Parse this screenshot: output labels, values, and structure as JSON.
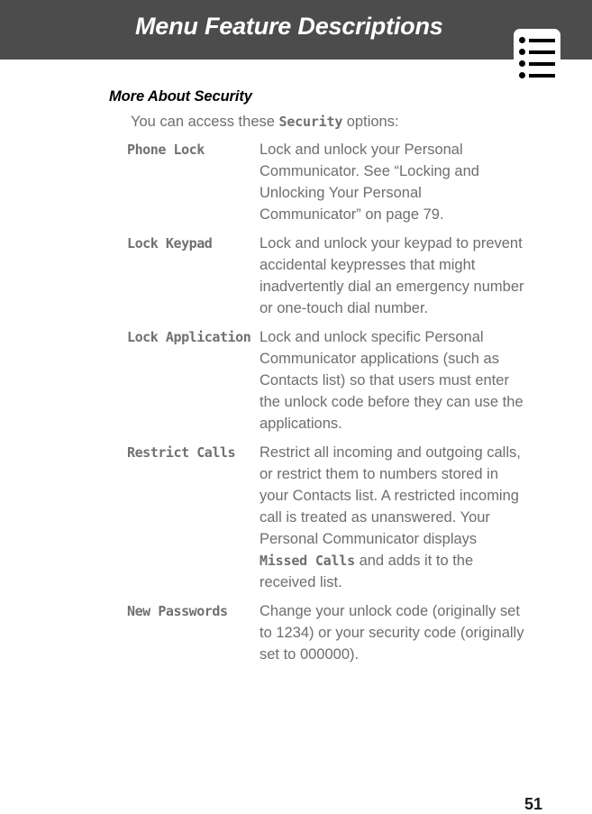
{
  "header": {
    "title": "Menu Feature Descriptions",
    "bar_color": "#4C4C4C",
    "title_color": "#FFFFFF",
    "icon_name": "bulleted-list-icon"
  },
  "section": {
    "heading": "More About Security",
    "intro_prefix": "You can access these ",
    "intro_keyword": "Security",
    "intro_suffix": " options:"
  },
  "definitions": [
    {
      "term": "Phone Lock",
      "description": "Lock and unlock your Personal Communicator. See “Locking and Unlocking Your Personal Communicator” on page 79."
    },
    {
      "term": "Lock Keypad",
      "description": "Lock and unlock your keypad to prevent accidental keypresses that might inadvertently dial an emergency number or one-touch dial number."
    },
    {
      "term": "Lock Application",
      "description": "Lock and unlock specific Personal Communicator applications (such as Contacts list) so that users must enter the unlock code before they can use the applications."
    },
    {
      "term": "Restrict Calls",
      "desc_part1": "Restrict all incoming and outgoing calls, or restrict them to numbers stored in your Contacts list. A restricted incoming call is treated as unanswered. Your Personal Communicator displays ",
      "desc_keyword": "Missed Calls",
      "desc_part2": " and adds it to the received list."
    },
    {
      "term": "New Passwords",
      "description": "Change your unlock code (originally set to 1234) or your security code (originally set to 000000)."
    }
  ],
  "footer": {
    "page_number": "51"
  },
  "colors": {
    "header_bg": "#4C4C4C",
    "body_text": "#6E6E6E",
    "term_text": "#707070",
    "heading_text": "#000000",
    "page_number": "#1A1A1A"
  }
}
